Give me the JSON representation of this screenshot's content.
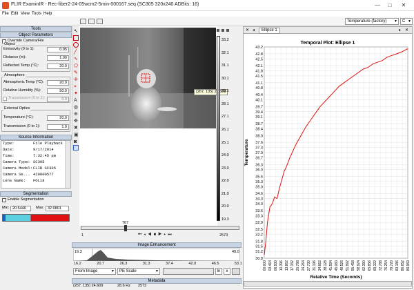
{
  "title": "FLIR ExaminIR - Rec-fiber2-24-05wcm2-5min-000167.seq (SC305 320x240 ADBits: 16)",
  "window": {
    "minimize": "—",
    "maximize": "□",
    "close": "✕"
  },
  "menu": [
    "File",
    "Edit",
    "View",
    "Tools",
    "Help"
  ],
  "toolbar": {
    "temperature_select": "Temperature (factory)",
    "unit_select": "C"
  },
  "tools": {
    "header": "Tools",
    "object_params": {
      "header": "Object Parameters",
      "override_label": "Override Camera/File",
      "object_group": "Object",
      "emissivity": {
        "label": "Emissivity (0 to 1):",
        "value": "0.95"
      },
      "distance": {
        "label": "Distance (m):",
        "value": "1.00"
      },
      "reflected": {
        "label": "Reflected Temp (°C):",
        "value": "20.0"
      },
      "atmosphere_group": "Atmosphere",
      "atm_temp": {
        "label": "Atmospheric Temp (°C):",
        "value": "20.0"
      },
      "humidity": {
        "label": "Relative Humidity (%):",
        "value": "50.0"
      },
      "transmission": {
        "label": "Transmission (0 to 1):",
        "value": "0.0"
      },
      "ext_optics_group": "External Optics",
      "ext_temp": {
        "label": "Temperature (°C):",
        "value": "20.0"
      },
      "ext_trans": {
        "label": "Transmission (0 to 1):",
        "value": "1.0"
      }
    },
    "source_info": {
      "header": "Source Information",
      "rows": [
        {
          "k": "Type:",
          "v": "File Playback"
        },
        {
          "k": "Date:",
          "v": "9/17/2014"
        },
        {
          "k": "Time:",
          "v": "7:32:45 pm"
        },
        {
          "k": "Camera Type:",
          "v": "SC305"
        },
        {
          "k": "Camera Model:",
          "v": "FLIR SC305"
        },
        {
          "k": "Camera Se...",
          "v": "429000577"
        },
        {
          "k": "Lens Name:",
          "v": "FOL18"
        }
      ]
    },
    "segmentation": {
      "header": "Segmentation",
      "enable_label": "Enable Segmentation",
      "min_label": "Min:",
      "min_value": "20.5446",
      "max_label": "Max:",
      "max_value": "32.0801"
    }
  },
  "image": {
    "cursor_readout": "(267, 135) 24.609",
    "scale_ticks": [
      "33.2",
      "32.1",
      "31.1",
      "30.1",
      "29.1",
      "28.1",
      "27.1",
      "26.1",
      "25.1",
      "24.0",
      "23.0",
      "22.0",
      "21.0",
      "20.0",
      "19.3"
    ]
  },
  "timeline": {
    "current": "767",
    "start": "1",
    "end": "2573"
  },
  "enhancement": {
    "header": "Image Enhancement",
    "low": "19.3",
    "high": "49.0",
    "ticks": [
      "16.2",
      "20.7",
      "26.3",
      "31.3",
      "37.4",
      "42.0",
      "46.5",
      "53.1"
    ],
    "source_select": "From Image",
    "scale_select": "PE Scale",
    "ln_label": "ln",
    "x_label": "x"
  },
  "metadata": {
    "header": "Metadata",
    "cursor": "(267, 135) 24.609",
    "rate": "28.6 Hz",
    "frame": "2573"
  },
  "plot_tab": "Ellipse 1",
  "chart_data": {
    "type": "line",
    "title": "Temporal Plot: Ellipse 1",
    "xlabel": "Relative Time (Seconds)",
    "ylabel": "Temperature",
    "xlim": [
      0,
      89.969
    ],
    "ylim": [
      30.8,
      43.2
    ],
    "xticks": [
      "00.000",
      "03.464",
      "06.930",
      "10.396",
      "13.862",
      "17.332",
      "20.798",
      "24.264",
      "27.730",
      "31.196",
      "34.662",
      "38.128",
      "41.594",
      "45.060",
      "48.526",
      "51.992",
      "55.458",
      "58.924",
      "62.390",
      "65.856",
      "69.322",
      "72.788",
      "76.254",
      "79.720",
      "83.186",
      "86.652",
      "89.969"
    ],
    "yticks": [
      30.8,
      31.2,
      31.5,
      31.8,
      32.2,
      32.5,
      32.9,
      33.3,
      33.6,
      34.0,
      34.3,
      34.6,
      35.0,
      35.3,
      35.6,
      36.0,
      36.3,
      36.7,
      37.0,
      37.3,
      37.6,
      38.0,
      38.4,
      38.7,
      39.1,
      39.4,
      39.7,
      40.1,
      40.4,
      40.8,
      41.1,
      41.5,
      41.8,
      42.1,
      42.5,
      42.8,
      43.2
    ],
    "color": "#dd1111",
    "series": [
      {
        "x": [
          0,
          1,
          2,
          3.5,
          5,
          6.5,
          8,
          9.5,
          11,
          12.5,
          14,
          16,
          18,
          20,
          23,
          26,
          29,
          32,
          35,
          38,
          41,
          44,
          47,
          50,
          53,
          56,
          59,
          62,
          65,
          68,
          71,
          74,
          77,
          80,
          83,
          86,
          88,
          89.969
        ],
        "values": [
          31.0,
          31.8,
          32.9,
          33.8,
          34.0,
          34.4,
          34.3,
          34.9,
          35.4,
          35.9,
          36.2,
          36.7,
          37.1,
          37.5,
          38.0,
          38.5,
          38.9,
          39.3,
          39.7,
          40.0,
          40.3,
          40.6,
          40.9,
          41.1,
          41.3,
          41.5,
          41.7,
          41.9,
          42.0,
          42.2,
          42.3,
          42.4,
          42.6,
          42.7,
          42.8,
          42.9,
          43.0,
          43.1
        ]
      }
    ]
  }
}
